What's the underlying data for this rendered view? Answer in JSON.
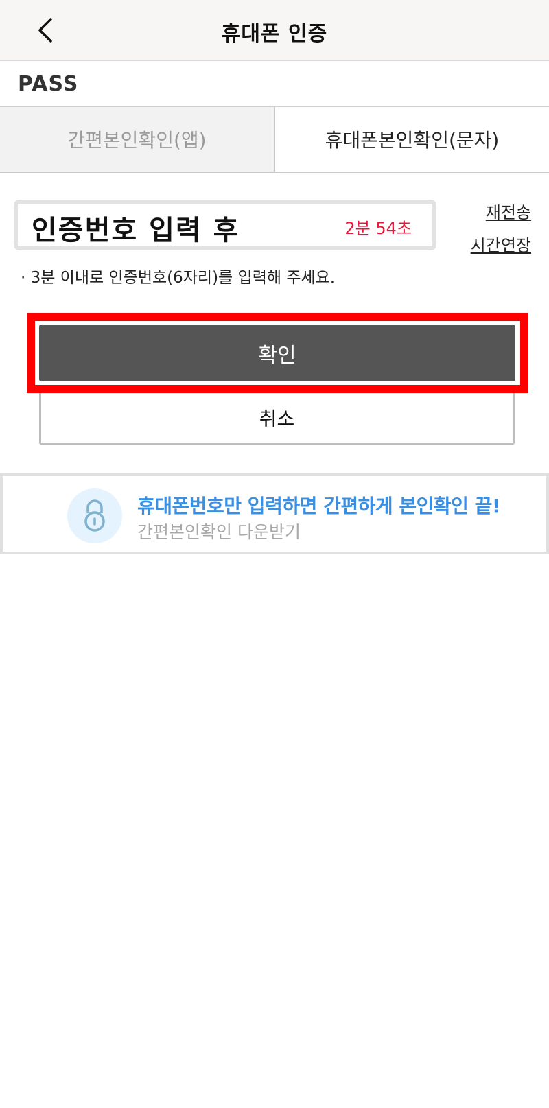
{
  "header": {
    "title": "휴대폰 인증",
    "back_icon": "chevron-left-icon"
  },
  "brand": {
    "logo_text": "PASS"
  },
  "tabs": [
    {
      "label": "간편본인확인(앱)",
      "active": false
    },
    {
      "label": "휴대폰본인확인(문자)",
      "active": true
    }
  ],
  "verification": {
    "code_placeholder": "인증번호 입력 후",
    "timer": "2분 54초",
    "resend_label": "재전송",
    "extend_label": "시간연장",
    "notice": "· 3분 이내로 인증번호(6자리)를 입력해 주세요."
  },
  "actions": {
    "confirm_label": "확인",
    "cancel_label": "취소",
    "highlight_color": "#ff0000"
  },
  "banner": {
    "icon": "lock-icon",
    "title": "휴대폰번호만 입력하면 간편하게 본인확인 끝!",
    "subtitle": "간편본인확인 다운받기",
    "accent_color": "#3b8fe0"
  }
}
